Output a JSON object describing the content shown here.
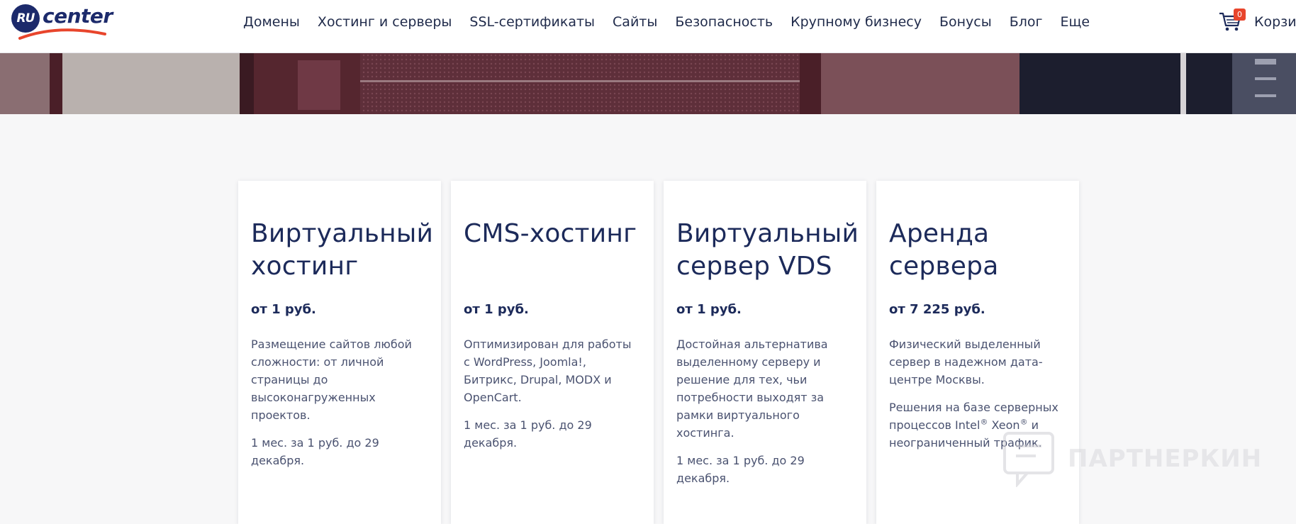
{
  "brand": {
    "logo_badge": "RU",
    "logo_word": "center"
  },
  "nav": {
    "items": [
      "Домены",
      "Хостинг и серверы",
      "SSL-сертификаты",
      "Сайты",
      "Безопасность",
      "Крупному бизнесу",
      "Бонусы",
      "Блог",
      "Еще"
    ]
  },
  "cart": {
    "count": "0",
    "label": "Корзин"
  },
  "cards": [
    {
      "title": "Виртуальный хостинг",
      "price": "от 1 руб.",
      "desc": "Размещение сайтов любой сложности: от личной страницы до высоконагруженных проектов.",
      "note": "1 мес. за 1 руб. до 29 декабря."
    },
    {
      "title": "CMS-хостинг",
      "price": "от 1 руб.",
      "desc": "Оптимизирован для работы с WordPress, Joomla!, Битрикс, Drupal, MODX и OpenCart.",
      "note": "1 мес. за 1 руб. до 29 декабря."
    },
    {
      "title": "Виртуальный сервер VDS",
      "price": "от 1 руб.",
      "desc": "Достойная альтернатива выделенному серверу и решение для тех, чьи потребности выходят за рамки виртуального хостинга.",
      "note": "1 мес. за 1 руб. до 29 декабря."
    },
    {
      "title": "Аренда сервера",
      "price": "от 7 225 руб.",
      "desc": "Физический выделенный сервер в надежном дата-центре Москвы.",
      "note_a": "Решения на базе серверных процессов Intel",
      "note_b": " Xeon",
      "note_c": " и неограниченный трафик.",
      "reg": "®"
    }
  ],
  "watermark": {
    "text": "ПАРТНЕРКИН"
  },
  "colors": {
    "brand_navy": "#1c2a6b",
    "badge_red": "#e8452c",
    "swoosh_red": "#e8452c"
  }
}
